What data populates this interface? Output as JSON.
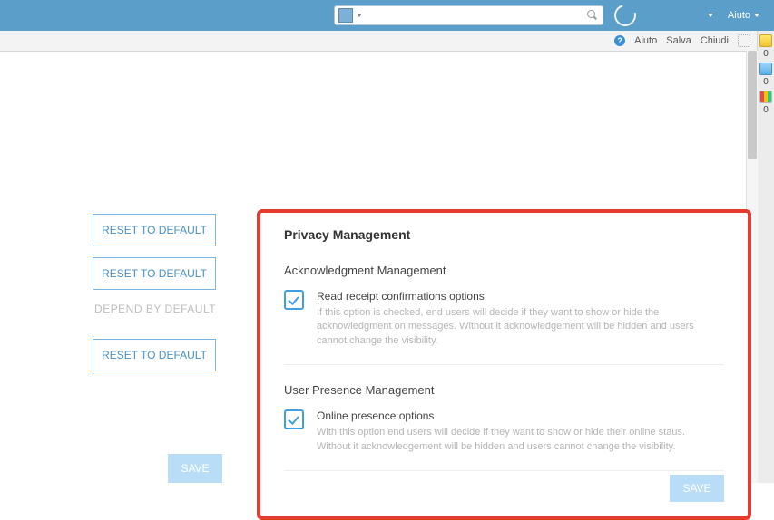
{
  "top": {
    "aiuto": "Aiuto"
  },
  "sub": {
    "aiuto": "Aiuto",
    "salva": "Salva",
    "chiudi": "Chiudi"
  },
  "rail": {
    "c0": "0",
    "c1": "0",
    "c2": "0"
  },
  "left": {
    "reset1": "RESET TO DEFAULT",
    "reset2": "RESET TO DEFAULT",
    "depend": "DEPEND BY DEFAULT",
    "reset3": "RESET TO DEFAULT",
    "save": "SAVE"
  },
  "card": {
    "title": "Privacy Management",
    "ack": {
      "section": "Acknowledgment Management",
      "opt": "Read receipt confirmations options",
      "desc": "If this option is checked, end users will decide if they want to show or hide the acknowledgment on messages. Without it acknowledgement will be hidden and users cannot change the visibility."
    },
    "pres": {
      "section": "User Presence Management",
      "opt": "Online presence options",
      "desc": "With this option end users will decide if they want to show or hide their online staus. Without it acknowledgement will be hidden and users cannot change the visibility."
    },
    "save": "SAVE"
  }
}
